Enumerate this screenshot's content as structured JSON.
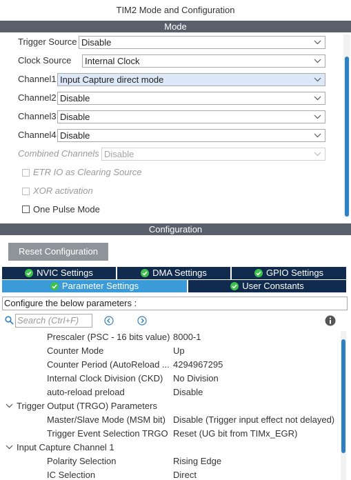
{
  "window": {
    "title": "TIM2 Mode and Configuration"
  },
  "mode": {
    "header": "Mode",
    "trigger_source": {
      "label": "Trigger Source",
      "value": "Disable"
    },
    "clock_source": {
      "label": "Clock Source",
      "value": "Internal Clock"
    },
    "channel1": {
      "label": "Channel1",
      "value": "Input Capture direct mode"
    },
    "channel2": {
      "label": "Channel2",
      "value": "Disable"
    },
    "channel3": {
      "label": "Channel3",
      "value": "Disable"
    },
    "channel4": {
      "label": "Channel4",
      "value": "Disable"
    },
    "combined_channels": {
      "label": "Combined Channels",
      "value": "Disable"
    },
    "etr_io": {
      "label": "ETR IO as Clearing Source"
    },
    "xor": {
      "label": "XOR activation"
    },
    "one_pulse": {
      "label": "One Pulse Mode"
    }
  },
  "configuration": {
    "header": "Configuration",
    "reset_label": "Reset Configuration",
    "tabs_top": [
      "NVIC Settings",
      "DMA Settings",
      "GPIO Settings"
    ],
    "tabs_bottom": [
      "Parameter Settings",
      "User Constants"
    ],
    "instructions": "Configure the below parameters :",
    "search_placeholder": "Search (Ctrl+F)",
    "params": {
      "prescaler": {
        "name": "Prescaler (PSC - 16 bits value)",
        "value": "8000-1"
      },
      "counter_mode": {
        "name": "Counter Mode",
        "value": "Up"
      },
      "counter_period": {
        "name": "Counter Period (AutoReload ...",
        "value": "4294967295"
      },
      "clock_division": {
        "name": "Internal Clock Division (CKD)",
        "value": "No Division"
      },
      "auto_reload": {
        "name": "auto-reload preload",
        "value": "Disable"
      },
      "trgo_group": "Trigger Output (TRGO) Parameters",
      "msm": {
        "name": "Master/Slave Mode (MSM bit)",
        "value": "Disable (Trigger input effect not delayed)"
      },
      "trgo_sel": {
        "name": "Trigger Event Selection TRGO",
        "value": "Reset (UG bit from TIMx_EGR)"
      },
      "ic1_group": "Input Capture Channel 1",
      "polarity": {
        "name": "Polarity Selection",
        "value": "Rising Edge"
      },
      "ic_sel": {
        "name": "IC Selection",
        "value": "Direct"
      }
    }
  },
  "colors": {
    "section_bar": "#59606b",
    "tab_dark": "#102b4e",
    "tab_active": "#3b9ad8",
    "scroll_thumb": "#2f7fc3",
    "check_green": "#3cc24a"
  }
}
